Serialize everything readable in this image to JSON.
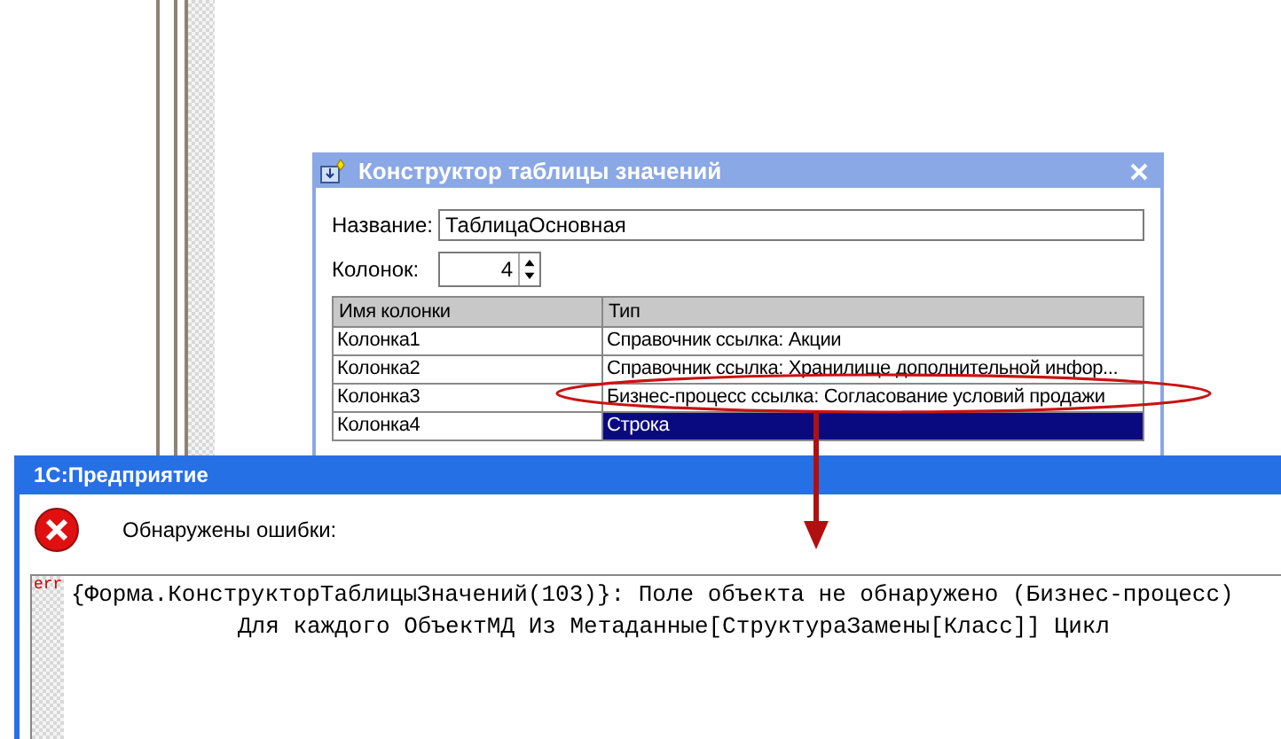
{
  "dialog": {
    "title": "Конструктор таблицы значений",
    "name_label": "Название:",
    "name_value": "ТаблицаОсновная",
    "count_label": "Колонок:",
    "count_value": "4",
    "table": {
      "columns": [
        "Имя колонки",
        "Тип"
      ],
      "rows": [
        {
          "cells": [
            "Колонка1",
            "Справочник ссылка: Акции"
          ],
          "selected": false
        },
        {
          "cells": [
            "Колонка2",
            "Справочник ссылка: Хранилище дополнительной инфор..."
          ],
          "selected": false
        },
        {
          "cells": [
            "Колонка3",
            "Бизнес-процесс ссылка: Согласование условий продажи"
          ],
          "selected": false
        },
        {
          "cells": [
            "Колонка4",
            "Строка"
          ],
          "selected": true
        }
      ]
    }
  },
  "error_window": {
    "title": "1С:Предприятие",
    "message": "Обнаружены ошибки:",
    "marker": "err",
    "lines": [
      {
        "kind": "error",
        "text": "{Форма.КонструкторТаблицыЗначений(103)}: Поле объекта не обнаружено (Бизнес-процесс)"
      },
      {
        "kind": "code",
        "text": "Для каждого ОбъектМД Из Метаданные[СтруктураЗамены[Класс]] Цикл"
      }
    ]
  }
}
